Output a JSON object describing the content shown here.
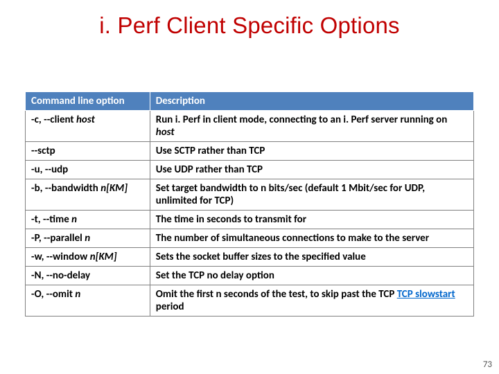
{
  "title": "i. Perf Client Specific Options",
  "table": {
    "headers": {
      "option": "Command line option",
      "description": "Description"
    },
    "rows": [
      {
        "opt_prefix": "-c, --client ",
        "opt_em": "host",
        "desc_prefix": "Run i. Perf in client mode, connecting to an i. Perf server running on ",
        "desc_em": "host"
      },
      {
        "opt_prefix": "--sctp",
        "desc_prefix": "Use SCTP rather than TCP"
      },
      {
        "opt_prefix": "-u, --udp",
        "desc_prefix": "Use UDP rather than TCP"
      },
      {
        "opt_prefix": "-b, --bandwidth ",
        "opt_em": "n[KM]",
        "desc_prefix": "Set target bandwidth to n bits/sec (default 1 Mbit/sec for UDP, unlimited for TCP)"
      },
      {
        "opt_prefix": "-t, --time ",
        "opt_em": "n",
        "desc_prefix": "The time in seconds to transmit for"
      },
      {
        "opt_prefix": "-P, --parallel ",
        "opt_em": "n",
        "desc_prefix": "The number of simultaneous connections to make to the server"
      },
      {
        "opt_prefix": "-w, --window ",
        "opt_em": "n[KM]",
        "desc_prefix": "Sets the socket buffer sizes to the specified value"
      },
      {
        "opt_prefix": "-N, --no-delay",
        "desc_prefix": "Set the TCP no delay option"
      },
      {
        "opt_prefix": "-O, --omit ",
        "opt_em": "n",
        "desc_prefix": "Omit the first n seconds of the test, to skip past the TCP ",
        "desc_link": "TCP slowstart",
        "desc_suffix": " period"
      }
    ]
  },
  "page_number": "73"
}
